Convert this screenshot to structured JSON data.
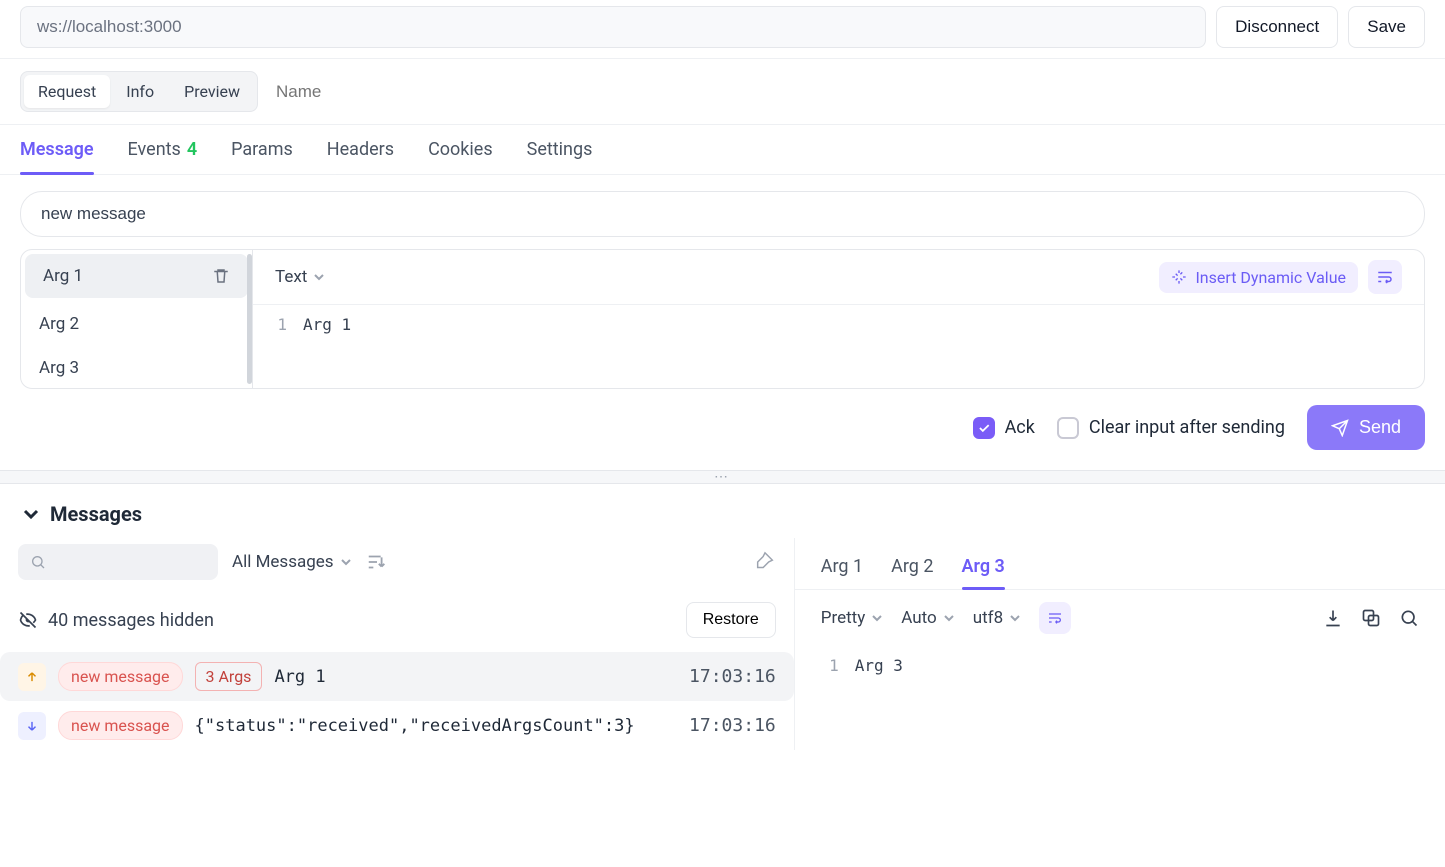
{
  "top": {
    "url": "ws://localhost:3000",
    "disconnect": "Disconnect",
    "save": "Save"
  },
  "viewTabs": {
    "request": "Request",
    "info": "Info",
    "preview": "Preview",
    "name_placeholder": "Name"
  },
  "mainTabs": {
    "message": "Message",
    "events": "Events",
    "events_badge": "4",
    "params": "Params",
    "headers": "Headers",
    "cookies": "Cookies",
    "settings": "Settings"
  },
  "messageBox": {
    "name": "new message",
    "args": [
      "Arg 1",
      "Arg 2",
      "Arg 3"
    ],
    "type_drop": "Text",
    "dynamic": "Insert Dynamic Value",
    "line_no": "1",
    "line": "Arg 1"
  },
  "sendBar": {
    "ack": "Ack",
    "clear": "Clear input after sending",
    "send": "Send"
  },
  "messagesSection": {
    "title": "Messages",
    "filter_label": "All Messages",
    "hidden_text": "40 messages hidden",
    "restore": "Restore",
    "rows": [
      {
        "dir": "up",
        "tag": "new message",
        "args_pill": "3 Args",
        "body": "Arg 1",
        "time": "17:03:16"
      },
      {
        "dir": "down",
        "tag": "new message",
        "body": "{\"status\":\"received\",\"receivedArgsCount\":3}",
        "time": "17:03:16"
      }
    ]
  },
  "response": {
    "tabs": [
      "Arg 1",
      "Arg 2",
      "Arg 3"
    ],
    "pretty": "Pretty",
    "auto": "Auto",
    "encoding": "utf8",
    "line_no": "1",
    "line": "Arg 3"
  }
}
